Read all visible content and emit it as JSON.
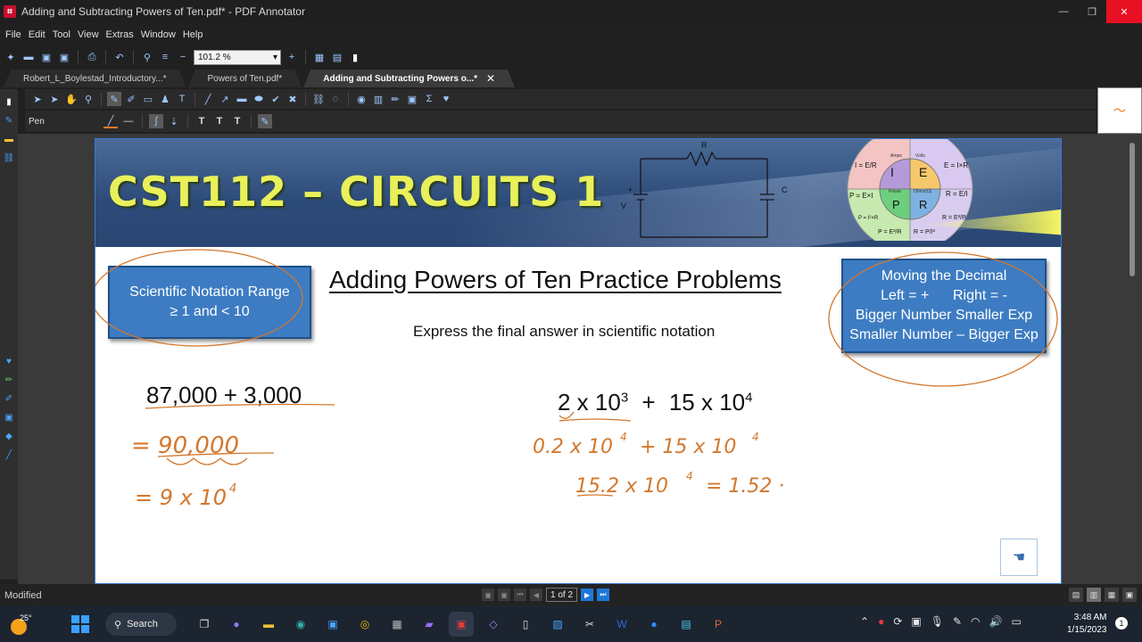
{
  "window": {
    "title": "Adding and Subtracting Powers of Ten.pdf* - PDF Annotator"
  },
  "menu": [
    "File",
    "Edit",
    "Tool",
    "View",
    "Extras",
    "Window",
    "Help"
  ],
  "toolbar": {
    "zoom": "101.2 %"
  },
  "tabs": [
    {
      "label": "Robert_L_Boylestad_Introductory...*"
    },
    {
      "label": "Powers of Ten.pdf*"
    },
    {
      "label": "Adding and Subtracting Powers o...*"
    }
  ],
  "tools": {
    "current_tool_label": "Pen",
    "style_buttons": [
      "T",
      "T",
      "T"
    ]
  },
  "slide": {
    "banner_title": "CST112 – CIRCUITS 1",
    "circuit_labels": {
      "r": "R",
      "v": "V",
      "c": "C",
      "plus": "+"
    },
    "wheel_labels": {
      "i": "I",
      "e": "E",
      "p": "P",
      "r": "R",
      "amps": "Amps",
      "volts": "Volts",
      "power": "Power",
      "ohms": "Ohms(Ω)",
      "f1": "I = E/R",
      "f2": "E = I×R",
      "f3": "P = E×I",
      "f4": "R = E/I",
      "f5": "P = I²×R",
      "f6": "P = E²/R",
      "f7": "R = P/I²",
      "f8": "R = E²/P"
    },
    "left_box": {
      "line1": "Scientific Notation Range",
      "line2": "≥ 1 and < 10"
    },
    "heading": "Adding Powers of Ten Practice Problems",
    "subheading": "Express the final answer in scientific notation",
    "right_box": {
      "line1": "Moving the Decimal",
      "line2": "Left = +      Right = -",
      "line3": "Bigger Number Smaller Exp",
      "line4": "Smaller Number – Bigger Exp"
    },
    "problem1": "87,000 + 3,000",
    "problem2": {
      "a": "2 x 10",
      "a_exp": "3",
      "op": "+",
      "b": "15 x 10",
      "b_exp": "4"
    },
    "handwriting": {
      "p1_line1": "= 90,000",
      "p1_line2": "= 9 x 10",
      "p1_line2_exp": "4",
      "p2_line1": "0.2 x 10",
      "p2_line1_exp": "4",
      "p2_line1_b": "+ 15 x 10",
      "p2_line1_b_exp": "4",
      "p2_line2": "15.2 x 10",
      "p2_line2_exp": "4",
      "p2_line2_b": "= 1.52 ·"
    },
    "ink_color": "#d2782e"
  },
  "status": {
    "text": "Modified",
    "page": "1 of 2"
  },
  "taskbar": {
    "temperature": "25°",
    "search_label": "Search",
    "time": "3:48 AM",
    "date": "1/15/2023",
    "notifications": "1"
  }
}
